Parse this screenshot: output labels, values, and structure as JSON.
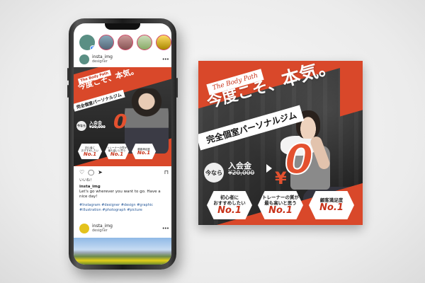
{
  "ad": {
    "brand_tag": "The Body Path",
    "headline_pre": "今度こそ、",
    "headline_strong": "本気。",
    "subhead": "完全個室パーソナルジム",
    "now_badge": "今なら",
    "fee_label": "入会金",
    "fee_old_price": "¥20,000",
    "fee_currency": "¥",
    "fee_new_price": "0",
    "badges": [
      {
        "line1": "初心者に",
        "line2": "おすすめしたい",
        "rank": "No.1"
      },
      {
        "line1": "トレーナーの質が",
        "line2": "最も高いと思う",
        "rank": "No.1"
      },
      {
        "line1": "顧客満足度",
        "line2": "",
        "rank": "No.1"
      }
    ]
  },
  "phone": {
    "post1": {
      "username": "insta_img",
      "role": "designer"
    },
    "likes": "いいね！",
    "caption_user": "insta_img",
    "caption": "Let's go wherever you want to go. Have a nice day!",
    "hashtags": "#Instagram #designer #design #graphic #illustration #photograph #picture",
    "post2": {
      "username": "insta_img",
      "role": "designer"
    }
  },
  "colors": {
    "accent": "#d9482a",
    "brand": "#c8331a"
  }
}
